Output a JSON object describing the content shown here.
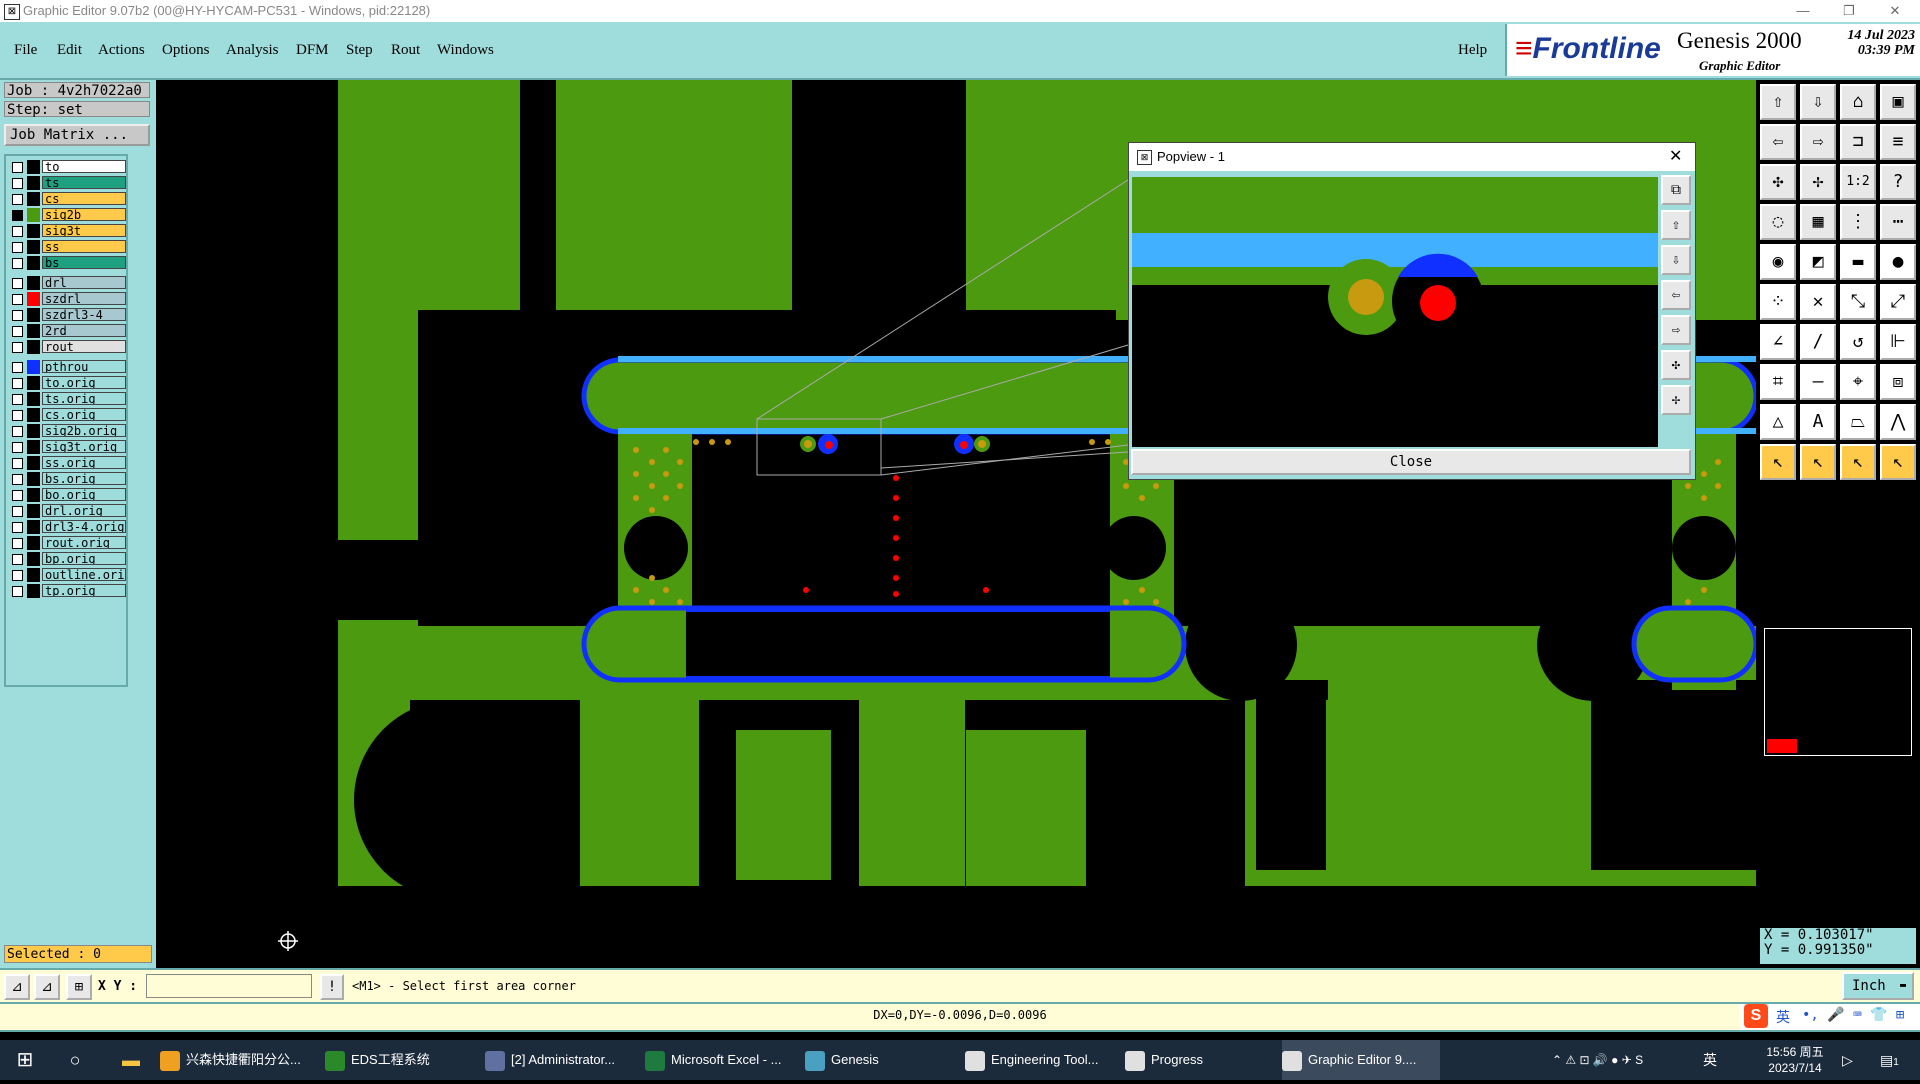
{
  "window": {
    "title": "Graphic Editor 9.07b2 (00@HY-HYCAM-PC531 - Windows, pid:22128)",
    "minimize": "—",
    "restore": "❐",
    "close": "✕"
  },
  "menu": {
    "items": [
      "File",
      "Edit",
      "Actions",
      "Options",
      "Analysis",
      "DFM",
      "Step",
      "Rout",
      "Windows"
    ],
    "help": "Help"
  },
  "brand": {
    "logo": "Frontline",
    "product": "Genesis 2000",
    "subtitle": "Graphic Editor",
    "date": "14 Jul 2023",
    "time": "03:39 PM"
  },
  "job": {
    "job_label": "Job : 4v2h7022a0",
    "step_label": "Step: set",
    "job_matrix": "Job Matrix ..."
  },
  "layers": [
    {
      "name": "to",
      "color": "#ffffff",
      "checked": false,
      "swatch": "#000000"
    },
    {
      "name": "ts",
      "color": "#1fa080",
      "checked": false,
      "swatch": "#000000"
    },
    {
      "name": "cs",
      "color": "#ffc94a",
      "checked": false,
      "swatch": "#000000"
    },
    {
      "name": "sig2b",
      "color": "#ffc94a",
      "checked": true,
      "swatch": "#4c9a10"
    },
    {
      "name": "sig3t",
      "color": "#ffc94a",
      "checked": false,
      "swatch": "#000000"
    },
    {
      "name": "ss",
      "color": "#ffc94a",
      "checked": false,
      "swatch": "#000000"
    },
    {
      "name": "bs",
      "color": "#1fa080",
      "checked": false,
      "swatch": "#000000"
    },
    {
      "name": "drl",
      "color": "#a8c8d0",
      "checked": false,
      "swatch": "#000000"
    },
    {
      "name": "szdrl",
      "color": "#a8c8d0",
      "checked": false,
      "swatch": "#ff0000"
    },
    {
      "name": "szdrl3-4",
      "color": "#a8c8d0",
      "checked": false,
      "swatch": "#000000"
    },
    {
      "name": "2rd",
      "color": "#a8c8d0",
      "checked": false,
      "swatch": "#000000"
    },
    {
      "name": "rout",
      "color": "#e0e0e0",
      "checked": false,
      "swatch": "#000000"
    },
    {
      "name": "pthrou",
      "color": "#9fdcdc",
      "checked": false,
      "swatch": "#1030ff"
    },
    {
      "name": "to.orig",
      "color": "#9fdcdc",
      "checked": false,
      "swatch": "#000000"
    },
    {
      "name": "ts.orig",
      "color": "#9fdcdc",
      "checked": false,
      "swatch": "#000000"
    },
    {
      "name": "cs.orig",
      "color": "#9fdcdc",
      "checked": false,
      "swatch": "#000000"
    },
    {
      "name": "sig2b.orig",
      "color": "#9fdcdc",
      "checked": false,
      "swatch": "#000000"
    },
    {
      "name": "sig3t.orig",
      "color": "#9fdcdc",
      "checked": false,
      "swatch": "#000000"
    },
    {
      "name": "ss.orig",
      "color": "#9fdcdc",
      "checked": false,
      "swatch": "#000000"
    },
    {
      "name": "bs.orig",
      "color": "#9fdcdc",
      "checked": false,
      "swatch": "#000000"
    },
    {
      "name": "bo.orig",
      "color": "#9fdcdc",
      "checked": false,
      "swatch": "#000000"
    },
    {
      "name": "drl.orig",
      "color": "#9fdcdc",
      "checked": false,
      "swatch": "#000000"
    },
    {
      "name": "drl3-4.orig",
      "color": "#9fdcdc",
      "checked": false,
      "swatch": "#000000"
    },
    {
      "name": "rout.orig",
      "color": "#9fdcdc",
      "checked": false,
      "swatch": "#000000"
    },
    {
      "name": "bp.orig",
      "color": "#9fdcdc",
      "checked": false,
      "swatch": "#000000"
    },
    {
      "name": "outline.orig",
      "color": "#9fdcdc",
      "checked": false,
      "swatch": "#000000"
    },
    {
      "name": "tp.orig",
      "color": "#9fdcdc",
      "checked": false,
      "swatch": "#000000"
    }
  ],
  "selected": "Selected : 0",
  "popview": {
    "title": "Popview - 1",
    "close_label": "Close"
  },
  "coords": {
    "x": "X = 0.103017\"",
    "y": "Y = 0.991350\""
  },
  "bottom": {
    "xy_label": "X Y :",
    "xy_value": "",
    "info_glyph": "!",
    "prompt": "<M1> - Select first area corner",
    "units": "Inch",
    "measure": "DX=0,DY=-0.0096,D=0.0096"
  },
  "taskbar": {
    "items": [
      {
        "label": "兴森快捷衢阳分公...",
        "color": "#f0a020"
      },
      {
        "label": "EDS工程系统",
        "color": "#2a8a2a"
      },
      {
        "label": "[2] Administrator...",
        "color": "#6070a0"
      },
      {
        "label": "Microsoft Excel - ...",
        "color": "#1f7a3f"
      },
      {
        "label": "Genesis",
        "color": "#4aa0c0"
      },
      {
        "label": "Engineering Tool...",
        "color": "#e0e0e0"
      },
      {
        "label": "Progress",
        "color": "#e0e0e0"
      },
      {
        "label": "Graphic Editor 9....",
        "color": "#e0e0e0"
      }
    ],
    "ime": "英",
    "clock_time": "15:56 周五",
    "clock_date": "2023/7/14",
    "notify_count": "1"
  },
  "colors": {
    "panel": "#9fdcdc",
    "copper": "#4c9a10",
    "trace_blue": "#1030ff",
    "trace_light": "#40b0ff",
    "pad_orange": "#c89a10",
    "drill_red": "#ff0000"
  }
}
